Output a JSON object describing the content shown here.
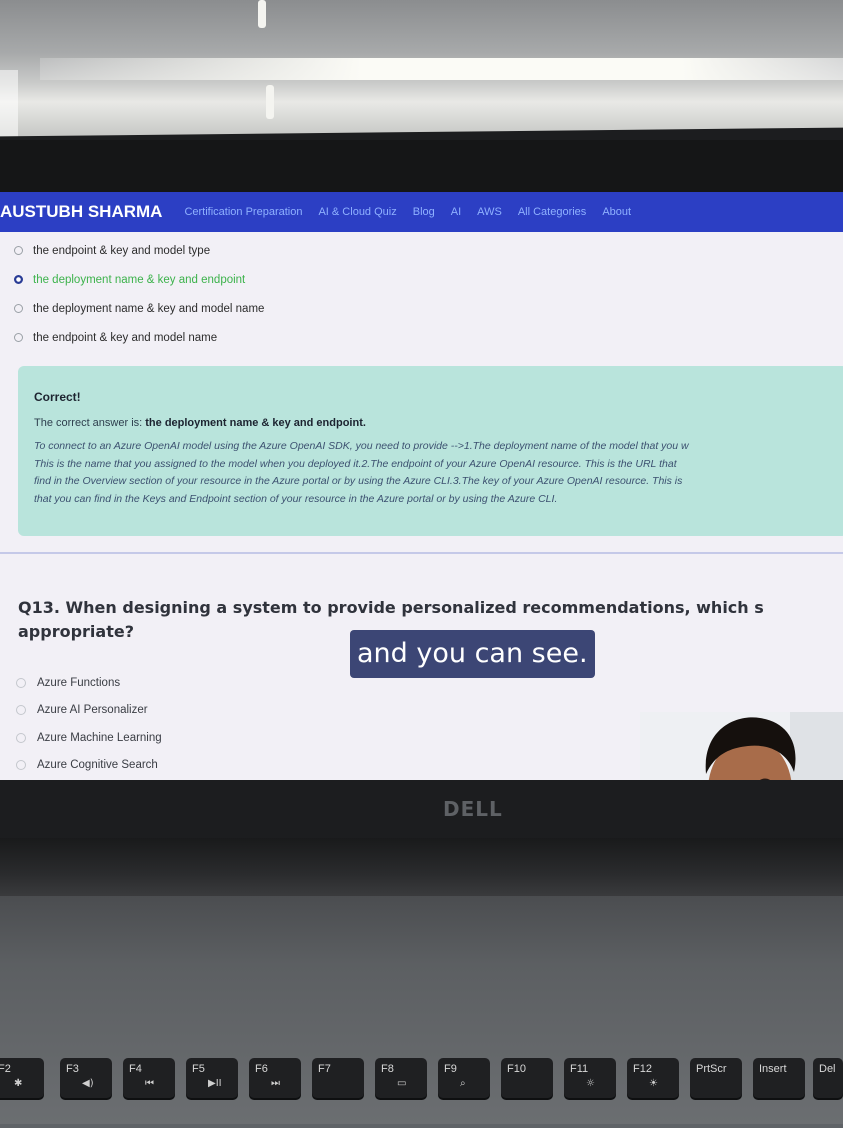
{
  "navbar": {
    "brand": "AUSTUBH SHARMA",
    "links": [
      "Certification Preparation",
      "AI & Cloud Quiz",
      "Blog",
      "AI",
      "AWS",
      "All Categories",
      "About"
    ]
  },
  "prev_question": {
    "options": [
      "the endpoint & key and model type",
      "the deployment name & key and endpoint",
      "the deployment name & key and model name",
      "the endpoint & key and model name"
    ],
    "selected_index": 1
  },
  "feedback": {
    "title": "Correct!",
    "answer_prefix": "The correct answer is:",
    "answer": "the deployment name & key and endpoint.",
    "explanation_lines": [
      "To connect to an Azure OpenAI model using the Azure OpenAI SDK, you need to provide -->1.The deployment name of the model that you w",
      "This is the name that you assigned to the model when you deployed it.2.The endpoint of your Azure OpenAI resource. This is the URL that",
      "find in the Overview section of your resource in the Azure portal or by using the Azure CLI.3.The key of your Azure OpenAI resource. This is",
      "that you can find in the Keys and Endpoint section of your resource in the Azure portal or by using the Azure CLI."
    ]
  },
  "question": {
    "line1": "Q13. When designing a system to provide personalized recommendations, which s",
    "line2": "appropriate?",
    "options": [
      "Azure Functions",
      "Azure AI Personalizer",
      "Azure Machine Learning",
      "Azure Cognitive Search"
    ]
  },
  "caption": "and you can see.",
  "laptop": {
    "logo": "DELL",
    "keys": [
      {
        "label": "F2",
        "icon": "✱"
      },
      {
        "label": "F3",
        "icon": "◀)"
      },
      {
        "label": "F4",
        "icon": "⏮"
      },
      {
        "label": "F5",
        "icon": "▶II"
      },
      {
        "label": "F6",
        "icon": "⏭"
      },
      {
        "label": "F7",
        "icon": ""
      },
      {
        "label": "F8",
        "icon": "▭"
      },
      {
        "label": "F9",
        "icon": "⌕"
      },
      {
        "label": "F10",
        "icon": ""
      },
      {
        "label": "F11",
        "icon": "☼"
      },
      {
        "label": "F12",
        "icon": "☀"
      },
      {
        "label": "PrtScr",
        "icon": ""
      },
      {
        "label": "Insert",
        "icon": ""
      },
      {
        "label": "Del",
        "icon": ""
      }
    ]
  },
  "colors": {
    "nav": "#2c3fc4",
    "feedback_bg": "#b9e4dc",
    "caption_bg": "#3c4675",
    "selected_text": "#3cb24b"
  }
}
